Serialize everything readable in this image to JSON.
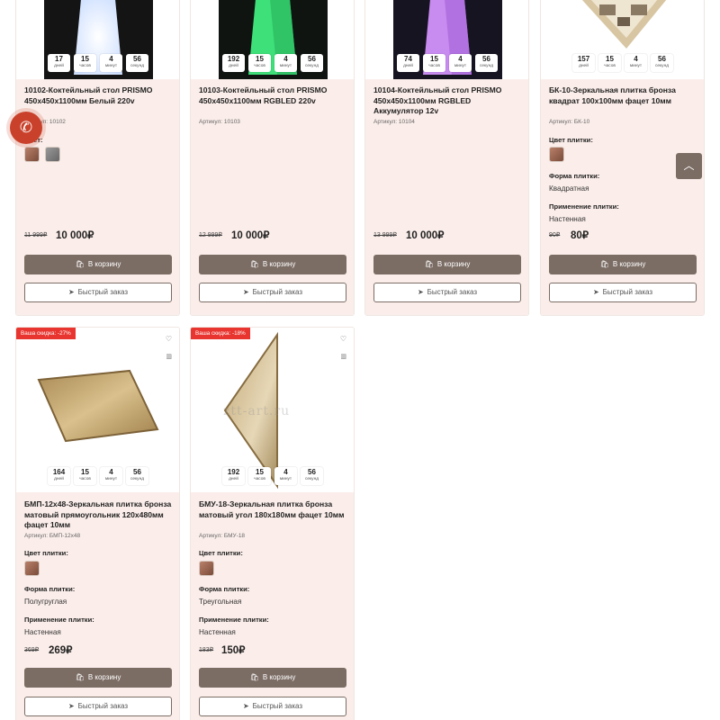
{
  "buttons": {
    "cart": "В корзину",
    "quick": "Быстрый заказ"
  },
  "timer_labels": {
    "days": "дней",
    "hours": "часов",
    "minutes": "минут",
    "seconds": "секунд"
  },
  "attr_labels": {
    "color": "Цвет плитки:",
    "color_short": "Цвет:",
    "shape": "Форма плитки:",
    "use": "Применение плитки:"
  },
  "products": [
    {
      "title": "10102-Коктейльный стол PRISMO 450х450х1100мм Белый 220v",
      "sku": "Артикул: 10102",
      "old_price": "11 999₽",
      "price": "10 000₽",
      "timer": {
        "days": "17",
        "hours": "15",
        "minutes": "4",
        "seconds": "56"
      }
    },
    {
      "title": "10103-Коктейльный стол PRISMO 450х450х1100мм RGBLED 220v",
      "sku": "Артикул: 10103",
      "old_price": "12 999₽",
      "price": "10 000₽",
      "timer": {
        "days": "192",
        "hours": "15",
        "minutes": "4",
        "seconds": "56"
      }
    },
    {
      "title": "10104-Коктейльный стол PRISMO 450х450х1100мм RGBLED Аккумулятор 12v",
      "sku": "Артикул: 10104",
      "old_price": "13 999₽",
      "price": "10 000₽",
      "timer": {
        "days": "74",
        "hours": "15",
        "minutes": "4",
        "seconds": "56"
      }
    },
    {
      "title": "БК-10-Зеркальная плитка бронза квадрат 100х100мм фацет 10мм",
      "sku": "Артикул: БК-10",
      "shape": "Квадратная",
      "use": "Настенная",
      "old_price": "90₽",
      "price": "80₽",
      "timer": {
        "days": "157",
        "hours": "15",
        "minutes": "4",
        "seconds": "56"
      }
    },
    {
      "badge": "Ваша скидка: -27%",
      "title": "БМП-12х48-Зеркальная плитка бронза матовый прямоугольник 120х480мм фацет 10мм",
      "sku": "Артикул: БМП-12х48",
      "shape": "Полугруглая",
      "use": "Настенная",
      "old_price": "369₽",
      "price": "269₽",
      "timer": {
        "days": "164",
        "hours": "15",
        "minutes": "4",
        "seconds": "56"
      }
    },
    {
      "badge": "Ваша скидка: -18%",
      "watermark": "ztt-art.ru",
      "title": "БМУ-18-Зеркальная плитка бронза матовый угол 180х180мм фацет 10мм",
      "sku": "Артикул: БМУ-18",
      "shape": "Треугольная",
      "use": "Настенная",
      "old_price": "183₽",
      "price": "150₽",
      "timer": {
        "days": "192",
        "hours": "15",
        "minutes": "4",
        "seconds": "56"
      }
    }
  ],
  "icons": {
    "phone": "phone-icon",
    "scroll_top": "chevron-up-icon",
    "cart": "bag-icon",
    "quick": "paper-plane-icon",
    "favorite": "heart-icon",
    "compare": "bar-chart-icon"
  },
  "colors": {
    "button": "#7b6c64",
    "badge": "#e8352f",
    "card_bg": "#fbeeea",
    "phone": "#c9412b"
  }
}
